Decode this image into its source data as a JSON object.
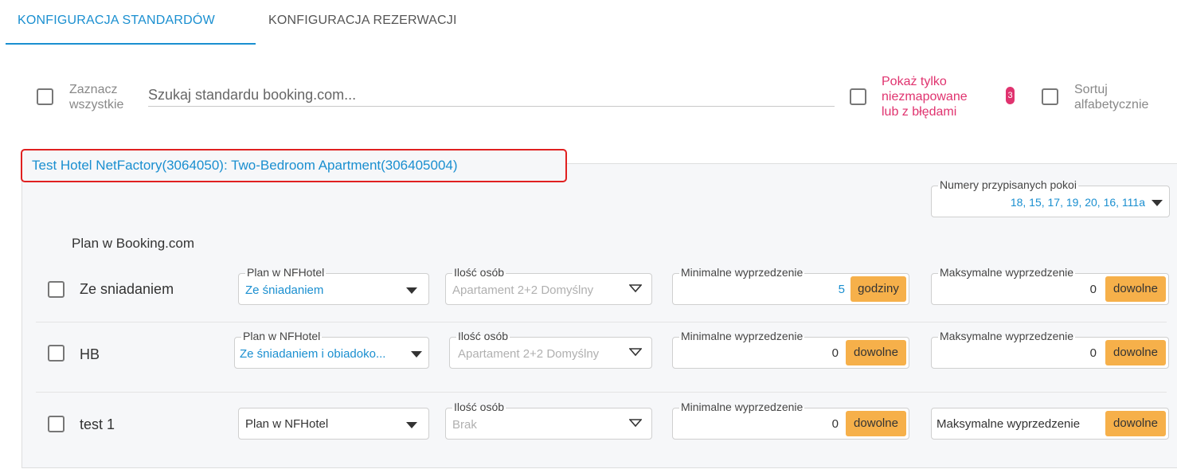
{
  "tabs": {
    "standards": "KONFIGURACJA STANDARDÓW",
    "reservations": "KONFIGURACJA REZERWACJI"
  },
  "toolbar": {
    "select_all_line1": "Zaznacz",
    "select_all_line2": "wszystkie",
    "search_placeholder": "Szukaj standardu booking.com...",
    "unmapped_line1": "Pokaż tylko",
    "unmapped_line2": "niezmapowane",
    "unmapped_line3": "lub z błędami",
    "unmapped_count": "3",
    "sort_line1": "Sortuj",
    "sort_line2": "alfabetycznie"
  },
  "panel": {
    "title": "Test Hotel NetFactory(3064050): Two-Bedroom Apartment(306405004)",
    "rooms_label": "Numery przypisanych pokoi",
    "rooms_value": "18, 15, 17, 19, 20, 16, 111a",
    "plan_header": "Plan w Booking.com"
  },
  "rows": [
    {
      "name": "Ze sniadaniem",
      "plan_label": "Plan w NFHotel",
      "plan_value": "Ze śniadaniem",
      "persons_label": "Ilość osób",
      "persons_value": "Apartament 2+2 Domyślny",
      "min_label": "Minimalne wyprzedzenie",
      "min_value": "5",
      "min_unit": "godziny",
      "max_label": "Maksymalne wyprzedzenie",
      "max_value": "0",
      "max_unit": "dowolne"
    },
    {
      "name": "HB",
      "plan_label": "Plan w NFHotel",
      "plan_value": "Ze śniadaniem i obiadoko...",
      "persons_label": "Ilość osób",
      "persons_value": "Apartament 2+2 Domyślny",
      "min_label": "Minimalne wyprzedzenie",
      "min_value": "0",
      "min_unit": "dowolne",
      "max_label": "Maksymalne wyprzedzenie",
      "max_value": "0",
      "max_unit": "dowolne"
    },
    {
      "name": "test 1",
      "plan_placeholder": "Plan w NFHotel",
      "persons_label": "Ilość osób",
      "persons_value": "Brak",
      "min_label": "Minimalne wyprzedzenie",
      "min_value": "0",
      "min_unit": "dowolne",
      "max_placeholder": "Maksymalne wyprzedzenie",
      "max_unit": "dowolne"
    }
  ],
  "colors": {
    "accent": "#1a8fd0",
    "pink": "#e0336f",
    "unit_bg": "#f6b04a",
    "highlight_border": "#e02020"
  }
}
